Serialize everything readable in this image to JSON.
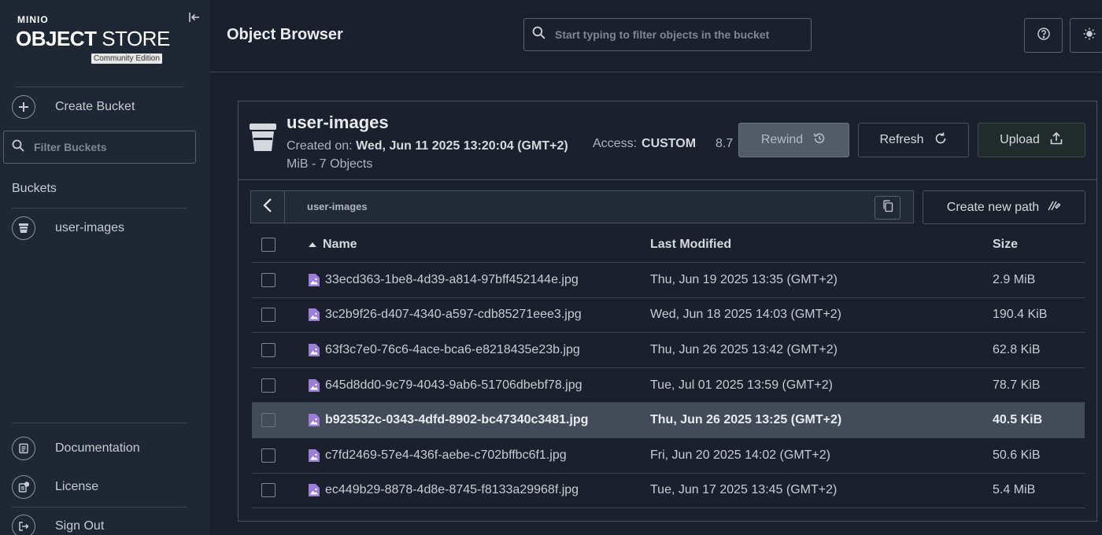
{
  "sidebar": {
    "logo_minio": "MINIO",
    "logo_object": "OBJECT",
    "logo_store": " STORE",
    "logo_edition": "Community Edition",
    "create_bucket": "Create Bucket",
    "filter_placeholder": "Filter Buckets",
    "buckets_heading": "Buckets",
    "buckets": [
      {
        "label": "user-images"
      }
    ],
    "documentation": "Documentation",
    "license": "License",
    "sign_out": "Sign Out"
  },
  "header": {
    "title": "Object Browser",
    "search_placeholder": "Start typing to filter objects in the bucket"
  },
  "bucket": {
    "name": "user-images",
    "created_label": "Created on: ",
    "created_value": "Wed, Jun 11 2025 13:20:04 (GMT+2)",
    "size_line": "MiB - 7 Objects",
    "access_label": "Access:",
    "access_value": "CUSTOM",
    "size_value": "8.7",
    "rewind_label": "Rewind",
    "refresh_label": "Refresh",
    "upload_label": "Upload"
  },
  "path": {
    "current": "user-images",
    "create_new_path": "Create new path"
  },
  "table": {
    "columns": {
      "name": "Name",
      "modified": "Last Modified",
      "size": "Size"
    },
    "rows": [
      {
        "name": "33ecd363-1be8-4d39-a814-97bff452144e.jpg",
        "modified": "Thu, Jun 19 2025 13:35 (GMT+2)",
        "size": "2.9 MiB"
      },
      {
        "name": "3c2b9f26-d407-4340-a597-cdb85271eee3.jpg",
        "modified": "Wed, Jun 18 2025 14:03 (GMT+2)",
        "size": "190.4 KiB"
      },
      {
        "name": "63f3c7e0-76c6-4ace-bca6-e8218435e23b.jpg",
        "modified": "Thu, Jun 26 2025 13:42 (GMT+2)",
        "size": "62.8 KiB"
      },
      {
        "name": "645d8dd0-9c79-4043-9ab6-51706dbebf78.jpg",
        "modified": "Tue, Jul 01 2025 13:59 (GMT+2)",
        "size": "78.7 KiB"
      },
      {
        "name": "b923532c-0343-4dfd-8902-bc47340c3481.jpg",
        "modified": "Thu, Jun 26 2025 13:25 (GMT+2)",
        "size": "40.5 KiB"
      },
      {
        "name": "c7fd2469-57e4-436f-aebe-c702bffbc6f1.jpg",
        "modified": "Fri, Jun 20 2025 14:02 (GMT+2)",
        "size": "50.6 KiB"
      },
      {
        "name": "ec449b29-8878-4d8e-8745-f8133a29968f.jpg",
        "modified": "Tue, Jun 17 2025 13:45 (GMT+2)",
        "size": "5.4 MiB"
      }
    ]
  },
  "colors": {
    "file_icon": "#9b7fd6",
    "background": "#1b212c",
    "sidebar": "#1f2734",
    "selected_row": "#434b58"
  }
}
